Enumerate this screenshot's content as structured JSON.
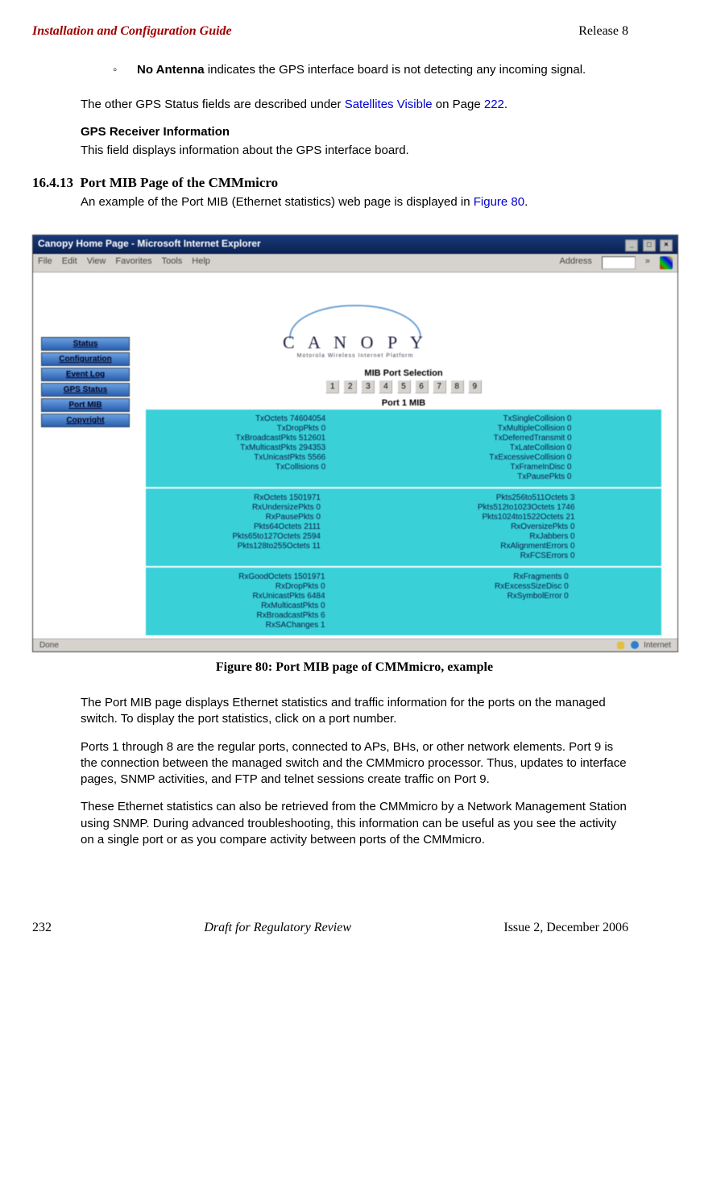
{
  "header": {
    "left": "Installation and Configuration Guide",
    "right": "Release 8"
  },
  "footer": {
    "page": "232",
    "center": "Draft for Regulatory Review",
    "right": "Issue 2, December 2006"
  },
  "bullet": {
    "dot": "◦",
    "label": "No Antenna",
    "rest": " indicates the GPS interface board is not detecting any incoming signal."
  },
  "para1_a": "The other GPS Status fields are described under ",
  "para1_link": "Satellites Visible",
  "para1_b": " on Page ",
  "para1_page": "222",
  "para1_c": ".",
  "gps": {
    "title": "GPS Receiver Information",
    "text": "This field displays information about the GPS interface board."
  },
  "section_num": "16.4.13",
  "section_title": "Port MIB Page of the CMMmicro",
  "para2_a": "An example of the Port MIB (Ethernet statistics) web page is displayed in ",
  "para2_link": "Figure 80",
  "para2_b": ".",
  "figure_caption": "Figure 80: Port MIB page of CMMmicro, example",
  "para3": "The Port MIB page displays Ethernet statistics and traffic information for the ports on the managed switch. To display the port statistics, click on a port number.",
  "para4": "Ports 1 through 8 are the regular ports, connected to APs, BHs, or other network elements. Port 9 is the connection between the managed switch and the CMMmicro processor. Thus, updates to interface pages, SNMP activities, and FTP and telnet sessions create traffic on Port 9.",
  "para5": "These Ethernet statistics can also be retrieved from the CMMmicro by a Network Management Station using SNMP. During advanced troubleshooting, this information can be useful as you see the activity on a single port or as you compare activity between ports of the CMMmicro.",
  "screenshot": {
    "title": "Canopy Home Page - Microsoft Internet Explorer",
    "menu": [
      "File",
      "Edit",
      "View",
      "Favorites",
      "Tools",
      "Help"
    ],
    "address_label": "Address",
    "logo": "C A N O P Y",
    "logo_sub": "Motorola Wireless Internet Platform",
    "nav": [
      "Status",
      "Configuration",
      "Event Log",
      "GPS Status",
      "Port MIB",
      "Copyright"
    ],
    "mib_title": "MIB Port Selection",
    "ports": [
      "1",
      "2",
      "3",
      "4",
      "5",
      "6",
      "7",
      "8",
      "9"
    ],
    "port_label": "Port 1 MIB",
    "block1_left": [
      "TxOctets 74604054",
      "TxDropPkts 0",
      "TxBroadcastPkts 512601",
      "TxMulticastPkts 294353",
      "TxUnicastPkts 5566",
      "TxCollisions 0"
    ],
    "block1_right": [
      "TxSingleCollision 0",
      "TxMultipleCollision 0",
      "TxDeferredTransmit 0",
      "TxLateCollision 0",
      "TxExcessiveCollision 0",
      "TxFrameInDisc 0",
      "TxPausePkts 0"
    ],
    "block2_left": [
      "RxOctets 1501971",
      "RxUndersizePkts 0",
      "RxPausePkts 0",
      "Pkts64Octets 2111",
      "Pkts65to127Octets 2594",
      "Pkts128to255Octets 11"
    ],
    "block2_right": [
      "Pkts256to511Octets 3",
      "Pkts512to1023Octets 1746",
      "Pkts1024to1522Octets 21",
      "RxOversizePkts 0",
      "RxJabbers 0",
      "RxAlignmentErrors 0",
      "RxFCSErrors 0"
    ],
    "block3_left": [
      "RxGoodOctets 1501971",
      "RxDropPkts 0",
      "RxUnicastPkts 6484",
      "RxMulticastPkts 0",
      "RxBroadcastPkts 6",
      "RxSAChanges 1"
    ],
    "block3_right": [
      "RxFragments 0",
      "",
      "RxExcessSizeDisc 0",
      "",
      "RxSymbolError 0"
    ],
    "status_left": "Done",
    "status_right": "Internet"
  }
}
